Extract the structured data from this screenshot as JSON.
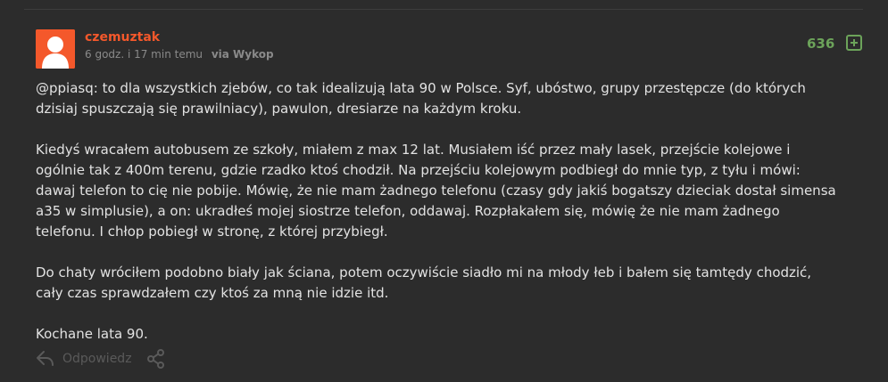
{
  "post": {
    "author": "czemuztak",
    "timestamp": "6 godz. i 17 min temu",
    "via": "via Wykop",
    "votes": "636",
    "mention": "@ppiasq",
    "paragraph1_rest": ": to dla wszystkich zjebów, co tak idealizują lata 90 w Polsce. Syf, ubóstwo, grupy przestępcze (do których dzisiaj spuszczają się prawilniacy), pawulon, dresiarze na każdym kroku.",
    "paragraph2": "Kiedyś wracałem autobusem ze szkoły, miałem z max 12 lat. Musiałem iść przez mały lasek, przejście kolejowe i ogólnie tak z 400m terenu, gdzie rzadko ktoś chodził. Na przejściu kolejowym podbiegł do mnie typ, z tyłu i mówi: dawaj telefon to cię nie pobije. Mówię, że nie mam żadnego telefonu (czasy gdy jakiś bogatszy dzieciak dostał simensa a35 w simplusie), a on: ukradłeś mojej siostrze telefon, oddawaj. Rozpłakałem się, mówię że nie mam żadnego telefonu. I chłop pobiegł w stronę, z której przybiegł.",
    "paragraph3": "Do chaty wróciłem podobno biały jak ściana, potem oczywiście siadło mi na młody łeb i bałem się tamtędy chodzić, cały czas sprawdzałem czy ktoś za mną nie idzie itd.",
    "paragraph4": "Kochane lata 90."
  },
  "actions": {
    "reply_label": "Odpowiedz"
  },
  "icons": {
    "avatar": "default-user-avatar",
    "plus": "plus-icon",
    "reply": "reply-arrow-icon",
    "share": "share-icon"
  },
  "colors": {
    "background": "#2c2c2c",
    "author": "#f4582b",
    "votes": "#6ca35a",
    "text": "#e2e2e2",
    "muted": "#8a8a8a"
  }
}
